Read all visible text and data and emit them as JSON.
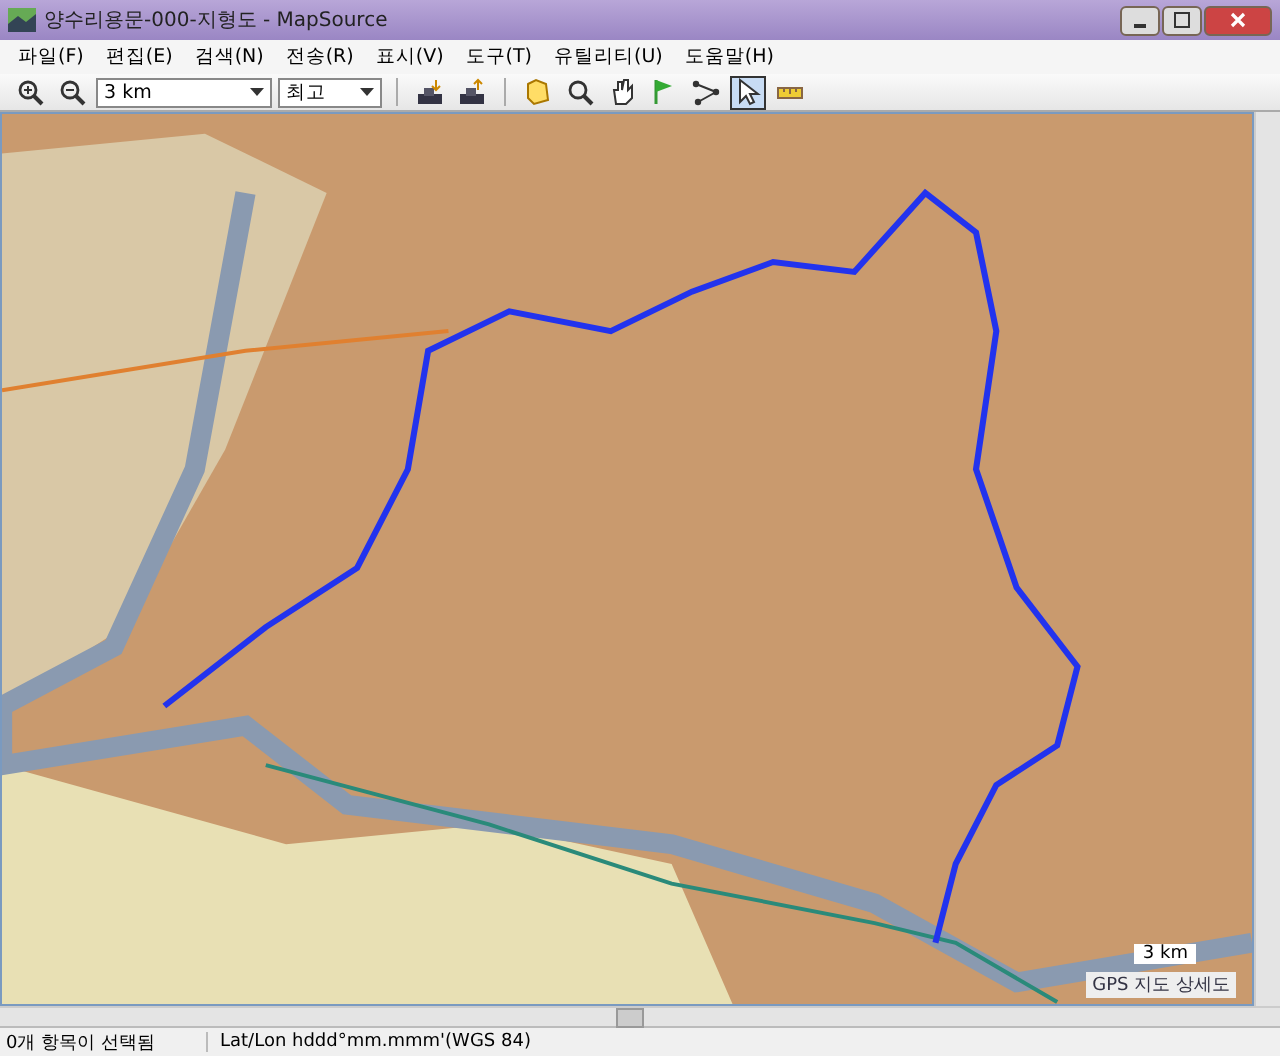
{
  "window": {
    "title": "양수리용문-000-지형도 - MapSource"
  },
  "menu": [
    "파일(F)",
    "편집(E)",
    "검색(N)",
    "전송(R)",
    "표시(V)",
    "도구(T)",
    "유틸리티(U)",
    "도움말(H)"
  ],
  "toolbar": {
    "zoom_select": {
      "value": "3 km"
    },
    "detail_select": {
      "value": "최고"
    },
    "tools": [
      {
        "kind": "zoom-in",
        "selected": false
      },
      {
        "kind": "zoom-out",
        "selected": false
      },
      {
        "kind": "receive",
        "selected": false
      },
      {
        "kind": "send",
        "selected": false
      },
      {
        "kind": "map",
        "selected": false
      },
      {
        "kind": "zoom",
        "selected": false
      },
      {
        "kind": "hand",
        "selected": false
      },
      {
        "kind": "flag",
        "selected": false
      },
      {
        "kind": "route",
        "selected": false
      },
      {
        "kind": "pointer",
        "selected": true
      },
      {
        "kind": "measure",
        "selected": false
      }
    ]
  },
  "map": {
    "scale": "3 km",
    "detail": "GPS 지도 상세도"
  },
  "status_bar": {
    "selection": "0개 항목이 선택됨",
    "coords": "Lat/Lon hddd°mm.mmm'(WGS 84)"
  }
}
